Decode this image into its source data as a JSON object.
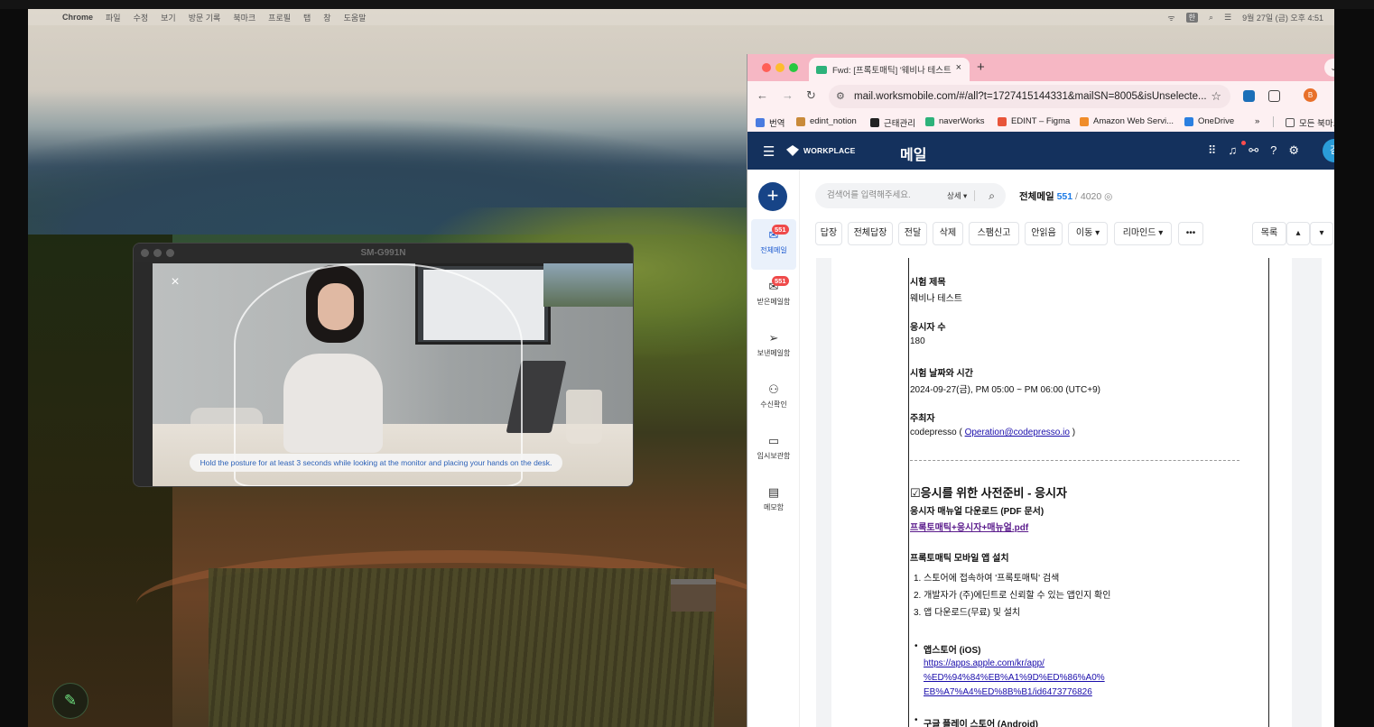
{
  "menubar": {
    "app": "Chrome",
    "items": [
      "파일",
      "수정",
      "보기",
      "방문 기록",
      "북마크",
      "프로필",
      "탭",
      "창",
      "도움말"
    ],
    "datetime": "9월 27일 (금) 오후 4:51",
    "input_badge": "한"
  },
  "mirror": {
    "title": "SM-G991N",
    "close_glyph": "×",
    "hint": "Hold the posture for at least 3 seconds while looking at the monitor and placing your hands on the desk."
  },
  "chrome": {
    "tab_title": "Fwd: [프록토매틱] '웨비나 테스트",
    "tab_close": "×",
    "new_tab": "+",
    "url": "mail.worksmobile.com/#/all?t=1727415144331&mailSN=8005&isUnselecte...",
    "profile_initial": "B",
    "bookmarks": [
      "번역",
      "edint_notion",
      "근태관리",
      "naverWorks",
      "EDINT – Figma",
      "Amazon Web Servi...",
      "OneDrive",
      "»",
      "모든 북마크"
    ]
  },
  "app": {
    "logo": "WORKPLACE",
    "title": "메일",
    "avatar": "김",
    "compose": "+",
    "nav": [
      {
        "label": "전체메일",
        "badge": "551",
        "icon": "✉"
      },
      {
        "label": "받은메일함",
        "badge": "551",
        "icon": "✉"
      },
      {
        "label": "보낸메일함",
        "badge": "",
        "icon": "➢"
      },
      {
        "label": "수신확인",
        "badge": "",
        "icon": "⚇"
      },
      {
        "label": "임시보관함",
        "badge": "",
        "icon": "▭"
      },
      {
        "label": "메모함",
        "badge": "",
        "icon": "▤"
      }
    ],
    "search": {
      "placeholder": "검색어를 입력해주세요.",
      "detail": "상세 ▾"
    },
    "count": {
      "label": "전체메일",
      "unread": "551",
      "sep": "/",
      "total": "4020"
    },
    "toolbar": [
      "답장",
      "전체답장",
      "전달",
      "삭제",
      "스팸신고",
      "안읽음",
      "이동 ▾",
      "리마인드 ▾",
      "•••",
      "목록",
      "▴",
      "▾"
    ]
  },
  "mail": {
    "exam_title_label": "시험 제목",
    "exam_title": "웨비나 테스트",
    "examinee_label": "응시자 수",
    "examinee_count": "180",
    "datetime_label": "시험 날짜와 시간",
    "datetime": "2024-09-27(금), PM 05:00 ~ PM 06:00 (UTC+9)",
    "host_label": "주최자",
    "host_prefix": "codepresso ( ",
    "host_email": "Operation@codepresso.io",
    "host_suffix": " )",
    "prep_heading": "☑응시를 위한 사전준비 - 응시자",
    "manual_label": "응시자 매뉴얼 다운로드 (PDF 문서)",
    "manual_file": "프록토매틱+응시자+매뉴얼.pdf",
    "install_label": "프록토매틱 모바일 앱 설치",
    "steps": [
      "1. 스토어에 접속하여 '프록토매틱' 검색",
      "2. 개발자가 (주)에딘트로 신뢰할 수 있는 앱인지 확인",
      "3. 앱 다운로드(무료) 및 설치"
    ],
    "appstore_label": "앱스토어 (iOS)",
    "appstore_link": [
      "https://apps.apple.com/kr/app/",
      "%ED%94%84%EB%A1%9D%ED%86%A0%",
      "EB%A7%A4%ED%8B%B1/id6473776826"
    ],
    "playstore_label": "구글 플레이 스토어 (Android)"
  }
}
